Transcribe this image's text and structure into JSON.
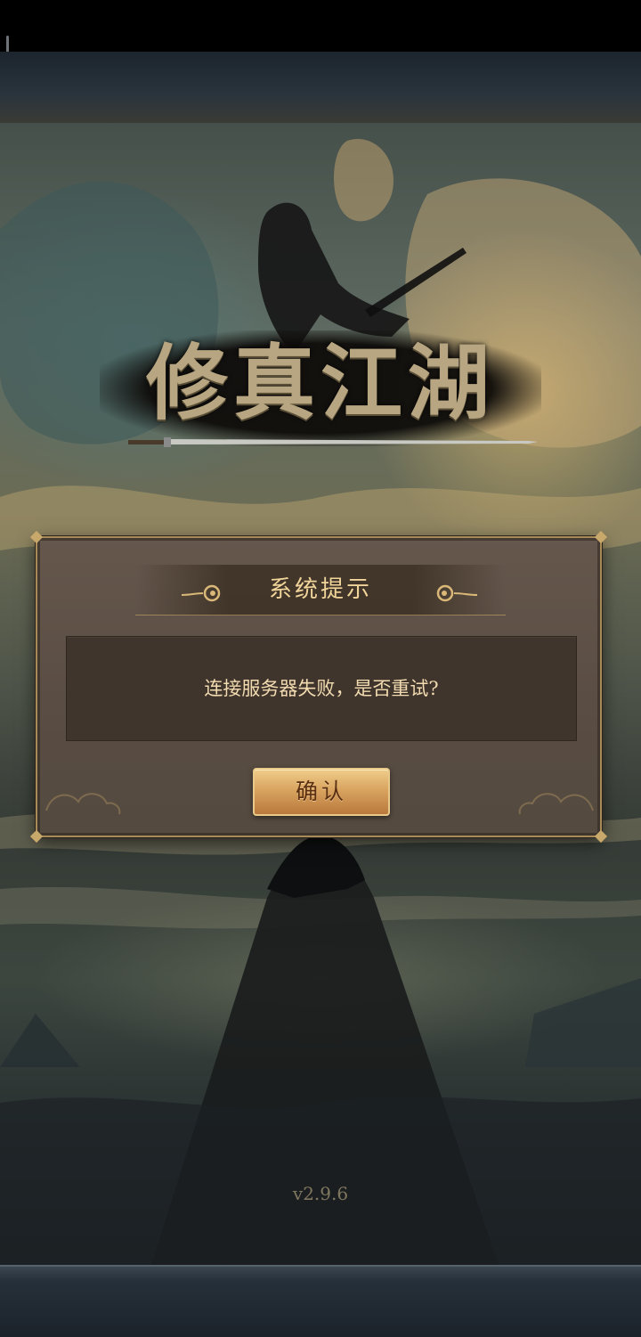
{
  "game": {
    "title": "修真江湖",
    "version": "v2.9.6"
  },
  "dialog": {
    "title": "系统提示",
    "message": "连接服务器失败，是否重试?",
    "confirm_label": "确认"
  },
  "icons": {
    "header_left": "cloud-ornament-icon",
    "header_right": "cloud-ornament-icon",
    "sword": "sword-icon"
  },
  "colors": {
    "dialog_title": "#f0d49a",
    "dialog_border": "#a88a58",
    "button_gold": "#d9a460",
    "logo_gold": "#b7a681"
  }
}
